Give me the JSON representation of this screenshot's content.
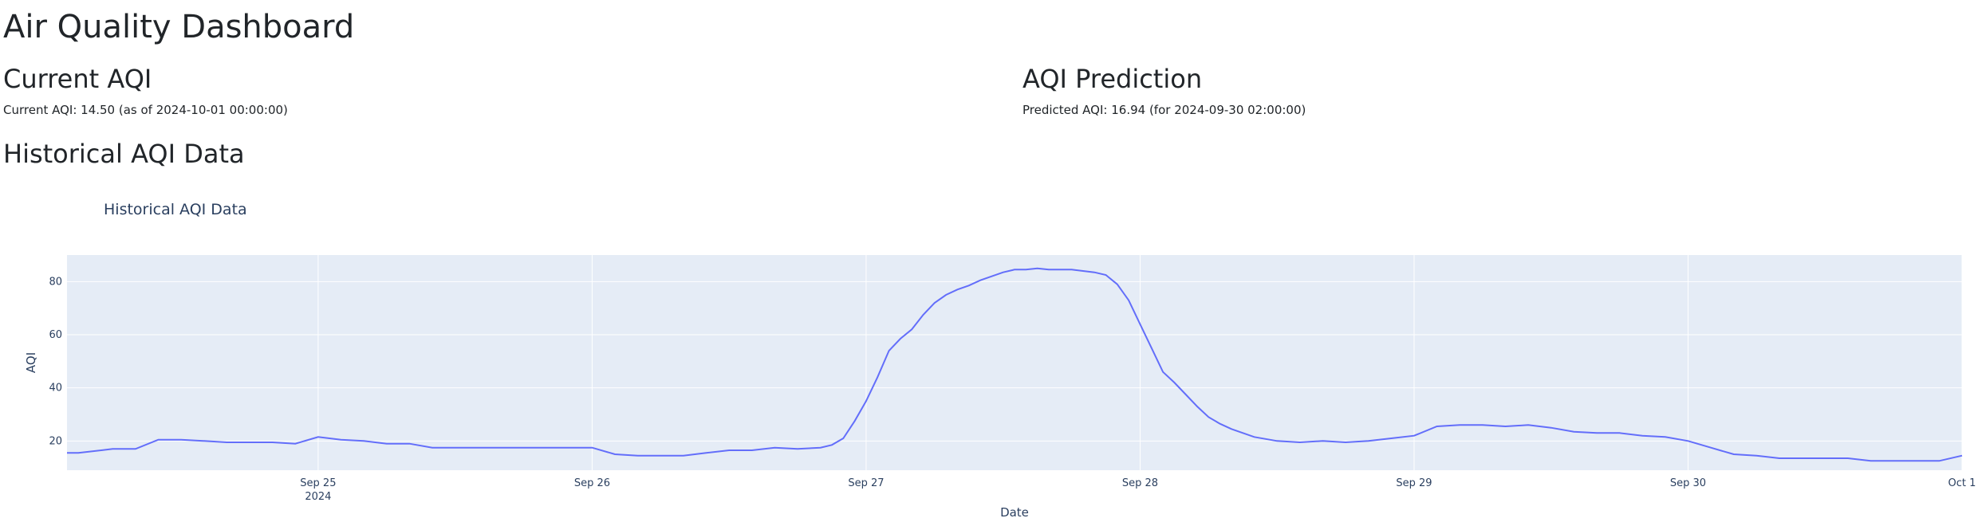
{
  "page": {
    "title": "Air Quality Dashboard",
    "current": {
      "heading": "Current AQI",
      "text": "Current AQI: 14.50 (as of 2024-10-01 00:00:00)"
    },
    "prediction": {
      "heading": "AQI Prediction",
      "text": "Predicted AQI: 16.94 (for 2024-09-30 02:00:00)"
    },
    "historical": {
      "heading": "Historical AQI Data"
    }
  },
  "colors": {
    "plot_bg": "#e5ecf6",
    "grid": "#ffffff",
    "line": "#636efa",
    "axis_text": "#2a3f5f"
  },
  "chart_data": {
    "type": "line",
    "title": "Historical AQI Data",
    "xlabel": "Date",
    "ylabel": "AQI",
    "xlim": [
      "2024-09-24 02:00",
      "2024-10-01 00:00"
    ],
    "ylim": [
      9,
      90
    ],
    "x_ticks": [
      {
        "label": "Sep 25",
        "sublabel": "2024",
        "value": "2024-09-25 00:00"
      },
      {
        "label": "Sep 26",
        "value": "2024-09-26 00:00"
      },
      {
        "label": "Sep 27",
        "value": "2024-09-27 00:00"
      },
      {
        "label": "Sep 28",
        "value": "2024-09-28 00:00"
      },
      {
        "label": "Sep 29",
        "value": "2024-09-29 00:00"
      },
      {
        "label": "Sep 30",
        "value": "2024-09-30 00:00"
      },
      {
        "label": "Oct 1",
        "value": "2024-10-01 00:00"
      }
    ],
    "y_ticks": [
      20,
      40,
      60,
      80
    ],
    "grid": true,
    "legend": "none",
    "series": [
      {
        "x": [
          "2024-09-24 02:00",
          "2024-09-24 03:00",
          "2024-09-24 06:00",
          "2024-09-24 08:00",
          "2024-09-24 10:00",
          "2024-09-24 12:00",
          "2024-09-24 14:00",
          "2024-09-24 16:00",
          "2024-09-24 18:00",
          "2024-09-24 20:00",
          "2024-09-24 22:00",
          "2024-09-25 00:00",
          "2024-09-25 02:00",
          "2024-09-25 04:00",
          "2024-09-25 06:00",
          "2024-09-25 08:00",
          "2024-09-25 10:00",
          "2024-09-25 12:00",
          "2024-09-25 14:00",
          "2024-09-25 16:00",
          "2024-09-25 18:00",
          "2024-09-25 20:00",
          "2024-09-25 22:00",
          "2024-09-26 00:00",
          "2024-09-26 02:00",
          "2024-09-26 04:00",
          "2024-09-26 06:00",
          "2024-09-26 08:00",
          "2024-09-26 10:00",
          "2024-09-26 12:00",
          "2024-09-26 14:00",
          "2024-09-26 16:00",
          "2024-09-26 18:00",
          "2024-09-26 20:00",
          "2024-09-26 21:00",
          "2024-09-26 22:00",
          "2024-09-26 23:00",
          "2024-09-27 00:00",
          "2024-09-27 01:00",
          "2024-09-27 02:00",
          "2024-09-27 03:00",
          "2024-09-27 04:00",
          "2024-09-27 05:00",
          "2024-09-27 06:00",
          "2024-09-27 07:00",
          "2024-09-27 08:00",
          "2024-09-27 09:00",
          "2024-09-27 10:00",
          "2024-09-27 11:00",
          "2024-09-27 12:00",
          "2024-09-27 13:00",
          "2024-09-27 14:00",
          "2024-09-27 15:00",
          "2024-09-27 16:00",
          "2024-09-27 18:00",
          "2024-09-27 20:00",
          "2024-09-27 21:00",
          "2024-09-27 22:00",
          "2024-09-27 23:00",
          "2024-09-28 00:00",
          "2024-09-28 01:00",
          "2024-09-28 02:00",
          "2024-09-28 03:00",
          "2024-09-28 04:00",
          "2024-09-28 05:00",
          "2024-09-28 06:00",
          "2024-09-28 07:00",
          "2024-09-28 08:00",
          "2024-09-28 09:00",
          "2024-09-28 10:00",
          "2024-09-28 12:00",
          "2024-09-28 14:00",
          "2024-09-28 16:00",
          "2024-09-28 18:00",
          "2024-09-28 20:00",
          "2024-09-28 22:00",
          "2024-09-29 00:00",
          "2024-09-29 02:00",
          "2024-09-29 04:00",
          "2024-09-29 06:00",
          "2024-09-29 08:00",
          "2024-09-29 10:00",
          "2024-09-29 12:00",
          "2024-09-29 14:00",
          "2024-09-29 16:00",
          "2024-09-29 18:00",
          "2024-09-29 20:00",
          "2024-09-29 22:00",
          "2024-09-30 00:00",
          "2024-09-30 02:00",
          "2024-09-30 04:00",
          "2024-09-30 06:00",
          "2024-09-30 08:00",
          "2024-09-30 10:00",
          "2024-09-30 12:00",
          "2024-09-30 14:00",
          "2024-09-30 16:00",
          "2024-09-30 18:00",
          "2024-09-30 20:00",
          "2024-09-30 22:00",
          "2024-10-01 00:00"
        ],
        "y": [
          15.5,
          15.5,
          17,
          17,
          20.5,
          20.5,
          20,
          19.5,
          19.5,
          19.5,
          19,
          21.5,
          20.5,
          20,
          19,
          19,
          17.5,
          17.5,
          17.5,
          17.5,
          17.5,
          17.5,
          17.5,
          17.5,
          15,
          14.5,
          14.5,
          14.5,
          15.5,
          16.5,
          16.5,
          17.5,
          17,
          17.5,
          18.5,
          21,
          27.5,
          35,
          44,
          54,
          58.5,
          62,
          67.5,
          72,
          75,
          77,
          78.5,
          80.5,
          82,
          83.5,
          84.5,
          84.5,
          85,
          84.5,
          84.5,
          83.5,
          82.5,
          79,
          73,
          64,
          55,
          46,
          42,
          37.5,
          33,
          29,
          26.5,
          24.5,
          23,
          21.5,
          20,
          19.5,
          20,
          19.5,
          20,
          21,
          22,
          25.5,
          26,
          26,
          25.5,
          26,
          25,
          23.5,
          23,
          23,
          22,
          21.5,
          20,
          17.5,
          15,
          14.5,
          13.5,
          13.5,
          13.5,
          13.5,
          12.5,
          12.5,
          12.5,
          12.5,
          14.5
        ]
      }
    ]
  }
}
